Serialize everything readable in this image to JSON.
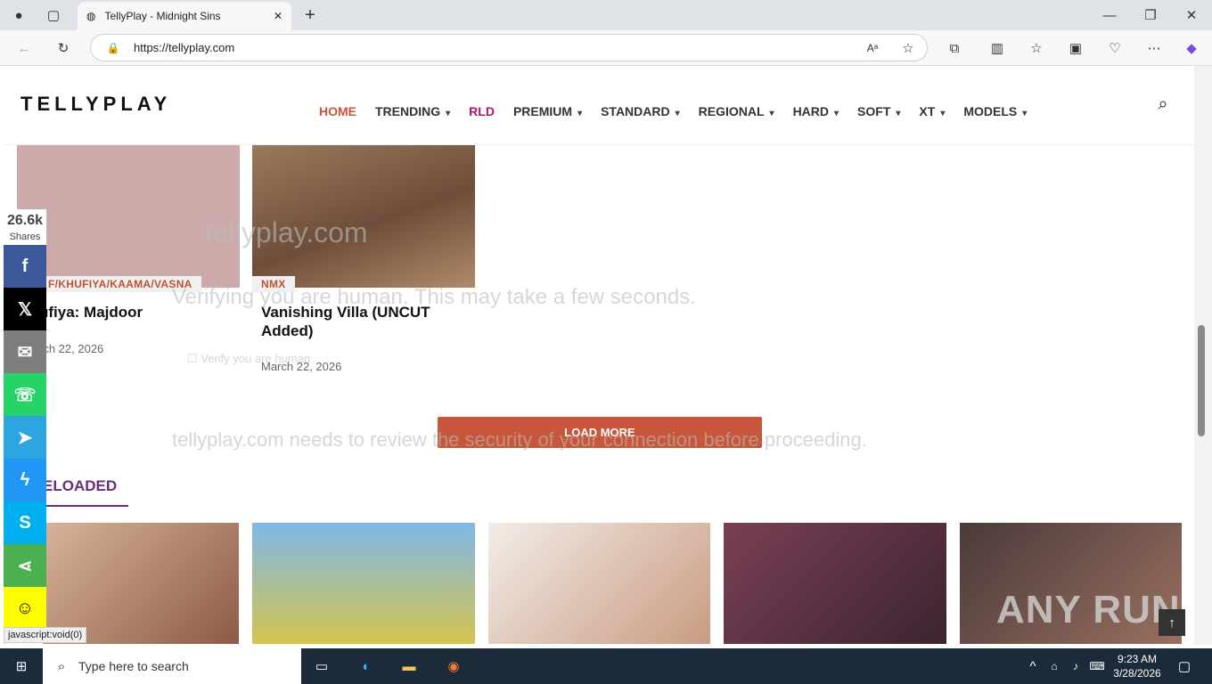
{
  "browser": {
    "tab_title": "TellyPlay - Midnight Sins",
    "url": "https://tellyplay.com",
    "status_text": "javascript:void(0)"
  },
  "site": {
    "logo": "TELLYPLAY",
    "nav": [
      "HOME",
      "TRENDING",
      "RLD",
      "PREMIUM",
      "STANDARD",
      "REGIONAL",
      "HARD",
      "SOFT",
      "XT",
      "MODELS"
    ],
    "nav_dropdown": [
      false,
      true,
      false,
      true,
      true,
      true,
      true,
      true,
      true,
      true
    ],
    "accent": "#c8563a"
  },
  "share": {
    "count": "26.6k",
    "label": "Shares"
  },
  "cards": [
    {
      "category": "F/KHUFIYA/KAAMA/VASNA",
      "title": "ufiya: Majdoor",
      "date": "rch 22, 2026"
    },
    {
      "category": "NMX",
      "title": "Vanishing Villa (UNCUT Added)",
      "date": "March 22, 2026"
    }
  ],
  "load_more": "LOAD MORE",
  "section": {
    "title": "ELOADED"
  },
  "overlay": {
    "verify": "Verifying you are human. This may take a few seconds.",
    "need": "tellyplay.com needs to review the security of your connection before proceeding.",
    "checkbox": "Verify you are human",
    "site": "tellyplay.com"
  },
  "watermark": "ANY RUN",
  "taskbar": {
    "search_placeholder": "Type here to search",
    "time": "9:23 AM",
    "date": "3/28/2026"
  }
}
